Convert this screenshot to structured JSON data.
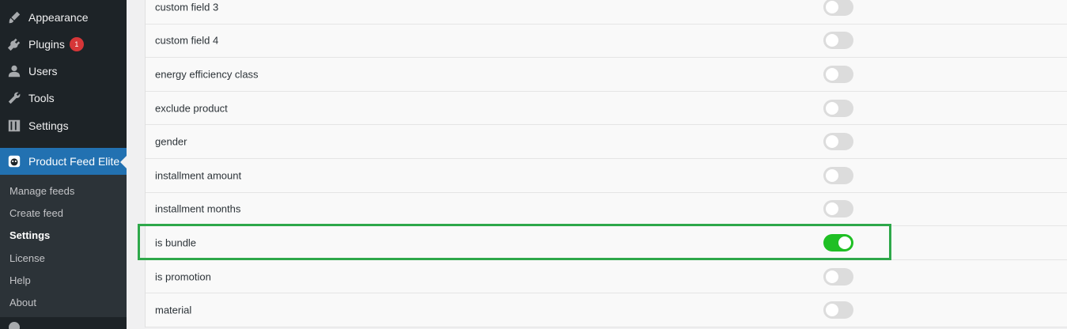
{
  "sidebar": {
    "items": [
      {
        "label": "Appearance",
        "icon": "paint-brush-icon"
      },
      {
        "label": "Plugins",
        "icon": "plug-icon",
        "badge": "1"
      },
      {
        "label": "Users",
        "icon": "user-icon"
      },
      {
        "label": "Tools",
        "icon": "wrench-icon"
      },
      {
        "label": "Settings",
        "icon": "sliders-icon"
      }
    ],
    "current": {
      "label": "Product Feed Elite",
      "icon": "plugin-logo-icon"
    },
    "submenu": [
      {
        "label": "Manage feeds"
      },
      {
        "label": "Create feed"
      },
      {
        "label": "Settings",
        "active": true
      },
      {
        "label": "License"
      },
      {
        "label": "Help"
      },
      {
        "label": "About"
      }
    ]
  },
  "fields": [
    {
      "label": "custom field 3",
      "enabled": false
    },
    {
      "label": "custom field 4",
      "enabled": false
    },
    {
      "label": "energy efficiency class",
      "enabled": false
    },
    {
      "label": "exclude product",
      "enabled": false
    },
    {
      "label": "gender",
      "enabled": false
    },
    {
      "label": "installment amount",
      "enabled": false
    },
    {
      "label": "installment months",
      "enabled": false
    },
    {
      "label": "is bundle",
      "enabled": true,
      "highlighted": true
    },
    {
      "label": "is promotion",
      "enabled": false
    },
    {
      "label": "material",
      "enabled": false
    }
  ],
  "colors": {
    "sidebar_bg": "#1d2327",
    "accent": "#2271b1",
    "toggle_on": "#1fbf24",
    "highlight_border": "#2ea84a",
    "badge": "#d63638"
  }
}
